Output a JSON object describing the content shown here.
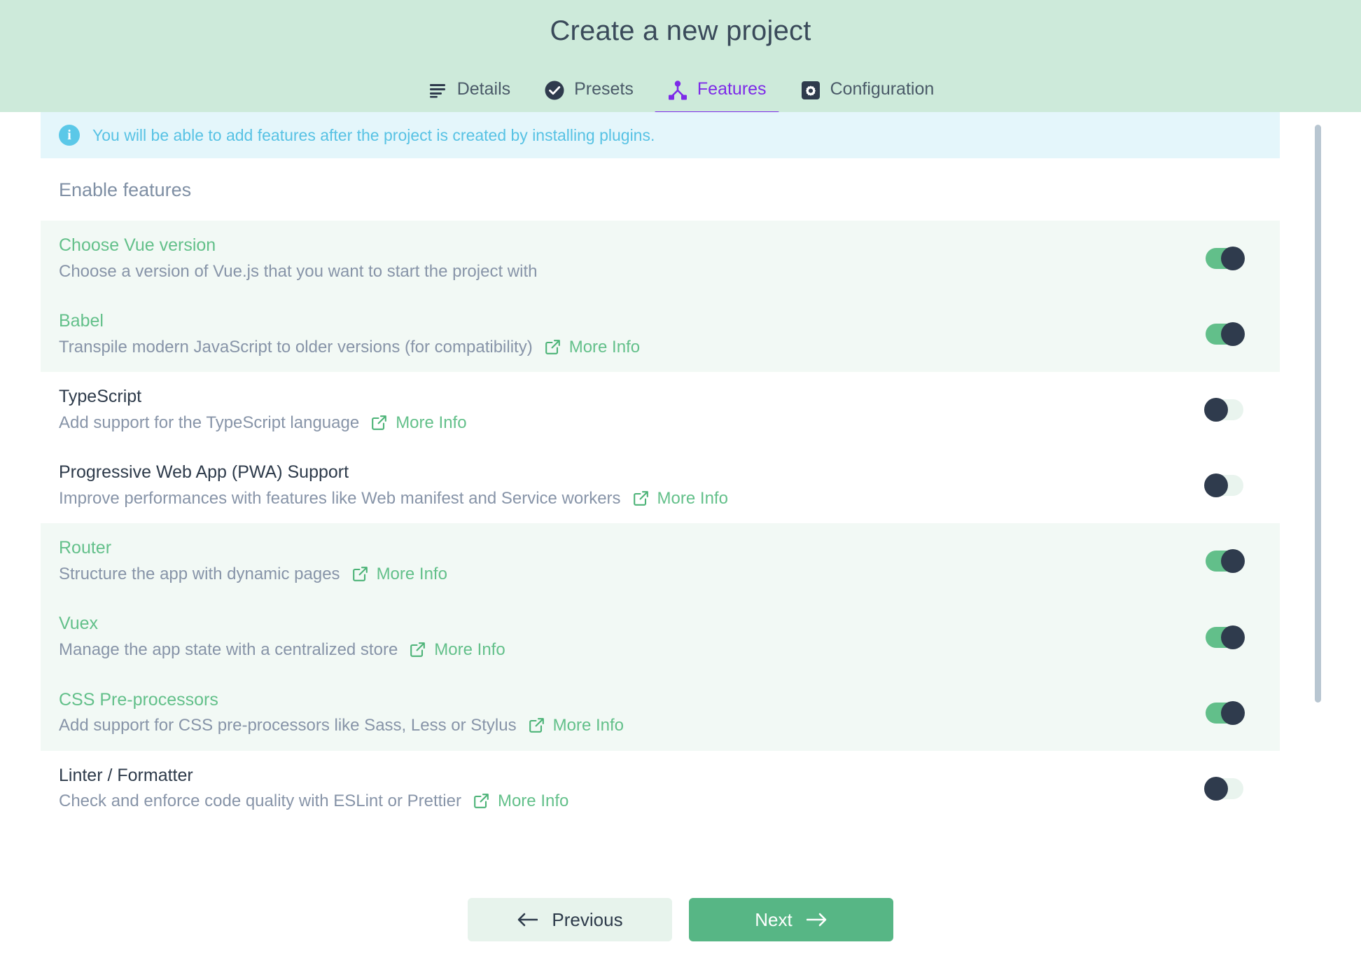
{
  "header": {
    "title": "Create a new project",
    "bg_color": "#cdeada",
    "active_tab_color": "#7d2ae8",
    "tabs": [
      {
        "label": "Details",
        "icon": "list-lines-icon",
        "active": false
      },
      {
        "label": "Presets",
        "icon": "check-circle-icon",
        "active": false
      },
      {
        "label": "Features",
        "icon": "sitemap-icon",
        "active": true
      },
      {
        "label": "Configuration",
        "icon": "gear-square-icon",
        "active": false
      }
    ]
  },
  "banner": {
    "icon": "info-icon",
    "text": "You will be able to add features after the project is created by installing plugins.",
    "bg_color": "#e4f6fb",
    "text_color": "#57c2e4"
  },
  "section": {
    "title": "Enable features"
  },
  "more_info_label": "More Info",
  "features": [
    {
      "title": "Choose Vue version",
      "description": "Choose a version of Vue.js that you want to start the project with",
      "has_more_info": false,
      "enabled": true
    },
    {
      "title": "Babel",
      "description": "Transpile modern JavaScript to older versions (for compatibility)",
      "has_more_info": true,
      "enabled": true
    },
    {
      "title": "TypeScript",
      "description": "Add support for the TypeScript language",
      "has_more_info": true,
      "enabled": false
    },
    {
      "title": "Progressive Web App (PWA) Support",
      "description": "Improve performances with features like Web manifest and Service workers",
      "has_more_info": true,
      "enabled": false
    },
    {
      "title": "Router",
      "description": "Structure the app with dynamic pages",
      "has_more_info": true,
      "enabled": true
    },
    {
      "title": "Vuex",
      "description": "Manage the app state with a centralized store",
      "has_more_info": true,
      "enabled": true
    },
    {
      "title": "CSS Pre-processors",
      "description": "Add support for CSS pre-processors like Sass, Less or Stylus",
      "has_more_info": true,
      "enabled": true
    },
    {
      "title": "Linter / Formatter",
      "description": "Check and enforce code quality with ESLint or Prettier",
      "has_more_info": true,
      "enabled": false
    }
  ],
  "footer": {
    "previous_label": "Previous",
    "next_label": "Next",
    "next_bg_color": "#57b685",
    "previous_bg_color": "#e7f3ec"
  }
}
